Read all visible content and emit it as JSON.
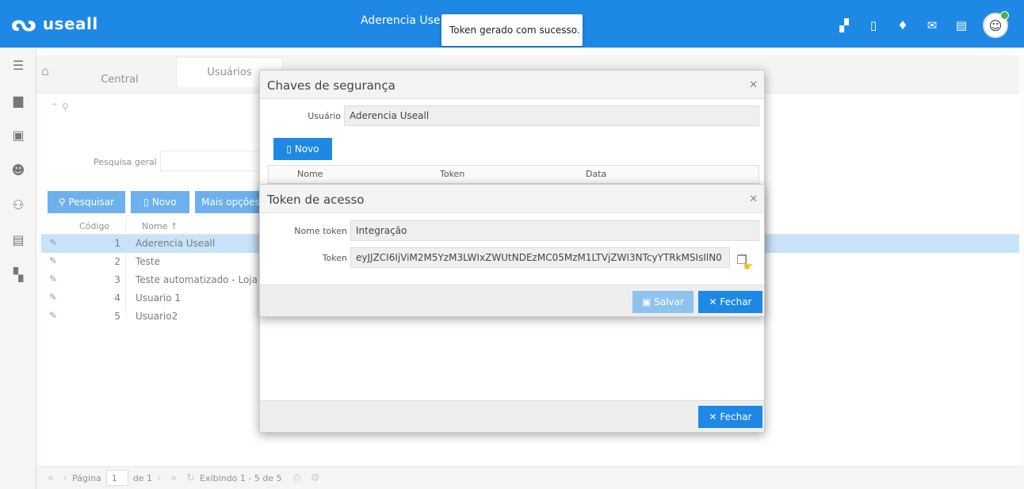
{
  "app": {
    "logo_text": "useall",
    "header_title": "Aderencia Useall",
    "toast": "Token gerado com sucesso."
  },
  "tabs": {
    "central": "Central",
    "usuarios": "Usuários"
  },
  "search": {
    "label": "Pesquisa geral"
  },
  "toolbar": {
    "pesquisar": "Pesquisar",
    "novo": "Novo",
    "mais": "Mais opções"
  },
  "grid": {
    "col_codigo": "Código",
    "col_nome": "Nome ↑",
    "rows": [
      {
        "codigo": "1",
        "nome": "Aderencia Useall"
      },
      {
        "codigo": "2",
        "nome": "Teste"
      },
      {
        "codigo": "3",
        "nome": "Teste automatizado - Loja"
      },
      {
        "codigo": "4",
        "nome": "Usuario 1"
      },
      {
        "codigo": "5",
        "nome": "Usuario2"
      }
    ]
  },
  "pager": {
    "pagina_label": "Página",
    "page_value": "1",
    "de_label": "de 1",
    "exibindo": "Exibindo 1 - 5 de 5"
  },
  "dialog_chaves": {
    "title": "Chaves de segurança",
    "usuario_label": "Usuário",
    "usuario_value": "Aderencia Useall",
    "novo": "Novo",
    "col_nome": "Nome",
    "col_token": "Token",
    "col_data": "Data",
    "fechar": "Fechar"
  },
  "dialog_token": {
    "title": "Token de acesso",
    "nome_token_label": "Nome token",
    "nome_token_value": "Integração",
    "token_label": "Token",
    "token_value": "eyJJZCI6IjViM2M5YzM3LWIxZWUtNDEzMC05MzM1LTVjZWI3NTcyYTRkMSIsIlN0",
    "salvar": "Salvar",
    "fechar": "Fechar"
  }
}
